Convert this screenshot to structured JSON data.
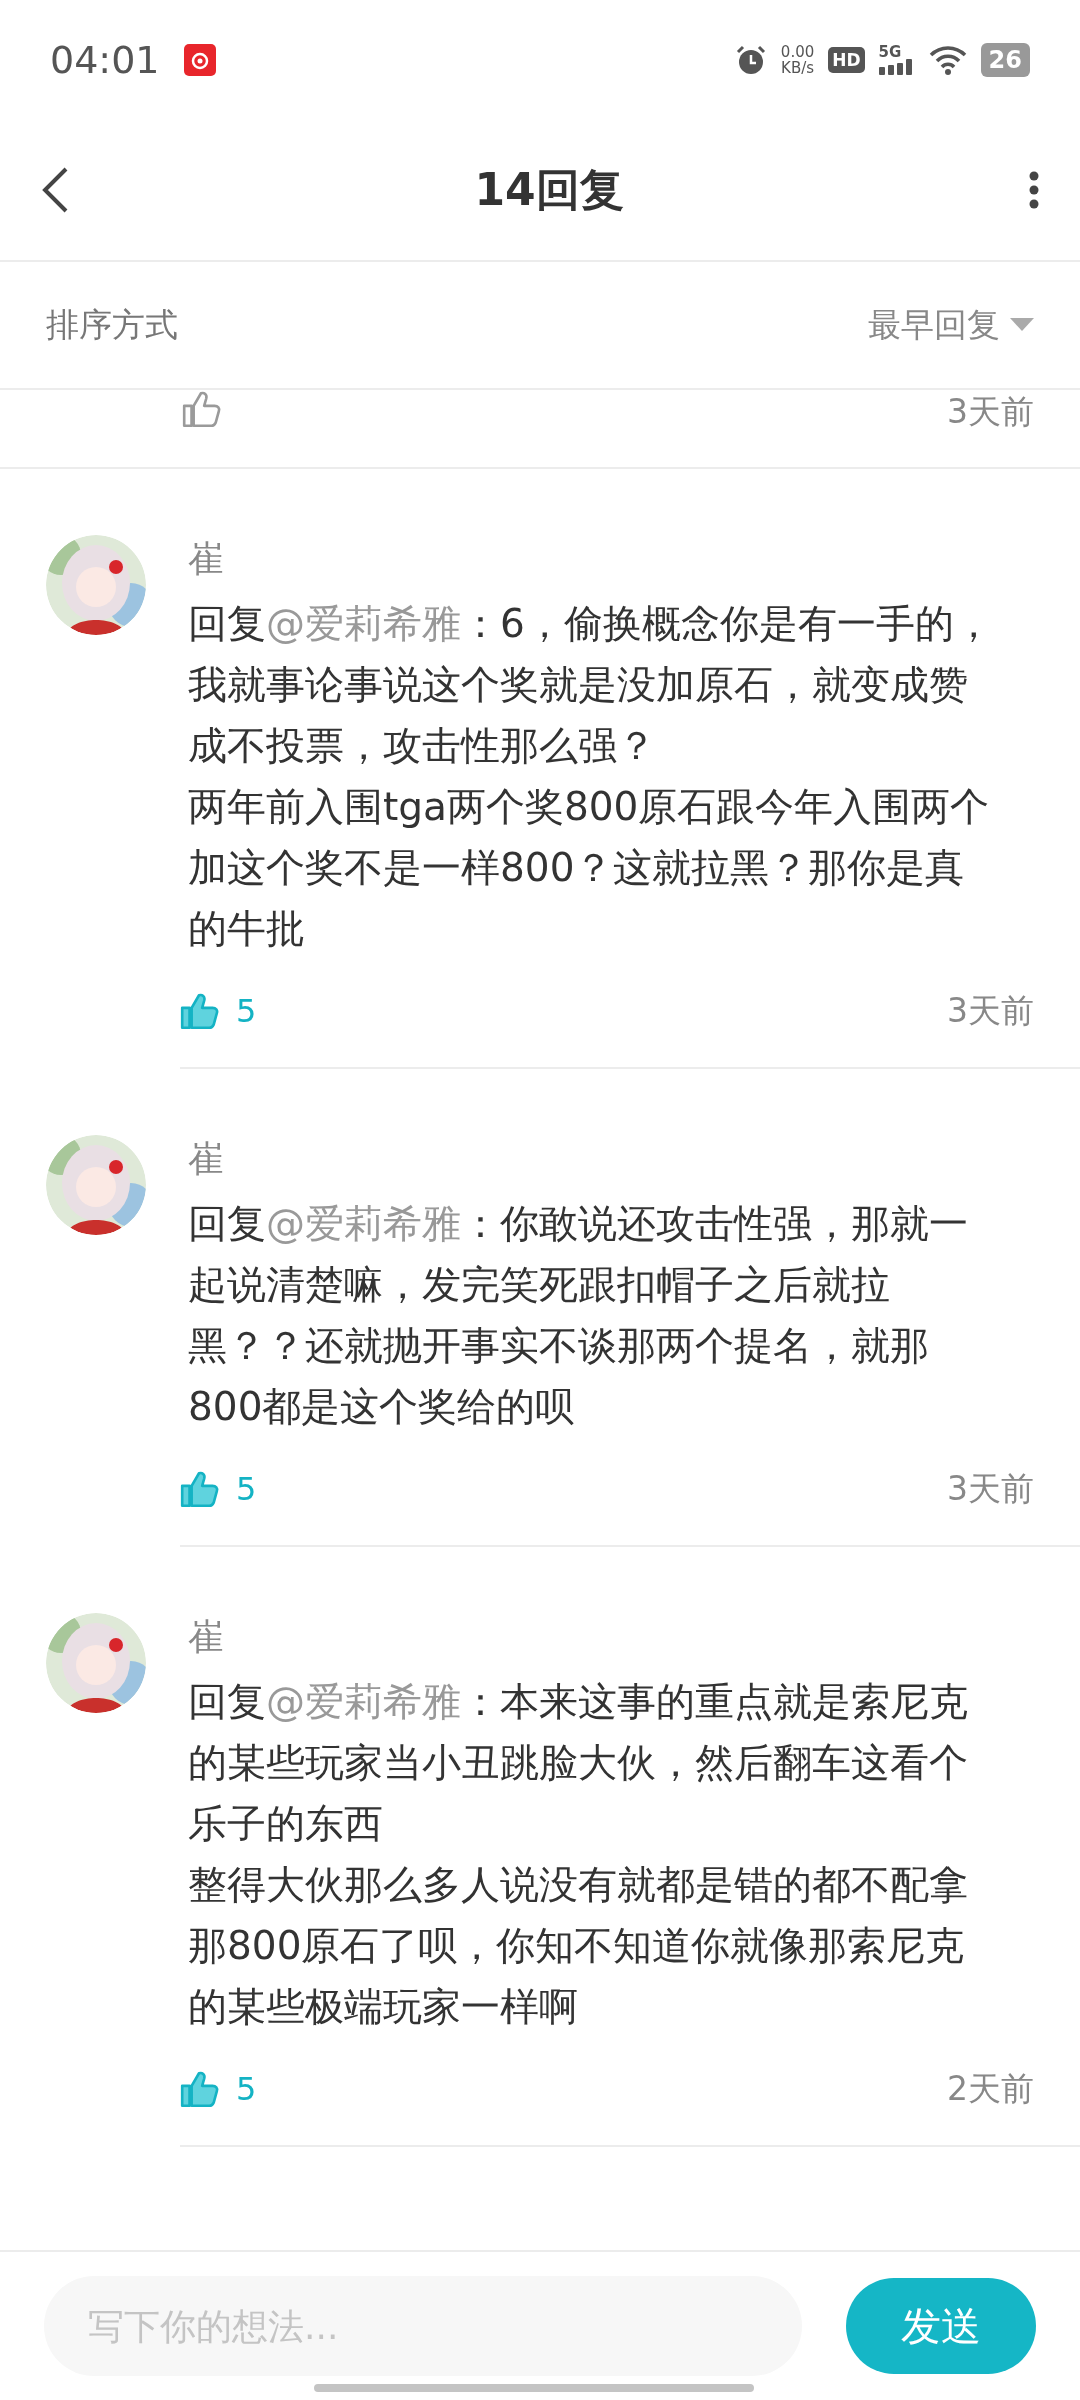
{
  "status_bar": {
    "time": "04:01",
    "net_speed": "0.00",
    "net_unit": "KB/s",
    "hd": "HD",
    "network": "5G",
    "battery": "26"
  },
  "header": {
    "title": "14回复"
  },
  "sort": {
    "label": "排序方式",
    "value": "最早回复"
  },
  "comments": [
    {
      "kind": "partial",
      "liked": false,
      "time": "3天前"
    },
    {
      "kind": "full",
      "name": "崔",
      "prefix": "回复",
      "mention": "@爱莉希雅",
      "text": "：6，偷换概念你是有一手的，我就事论事说这个奖就是没加原石，就变成赞成不投票，攻击性那么强？",
      "more_paragraphs": [
        "两年前入围tga两个奖800原石跟今年入围两个加这个奖不是一样800？这就拉黑？那你是真的牛批"
      ],
      "liked": true,
      "likes": "5",
      "time": "3天前"
    },
    {
      "kind": "full",
      "name": "崔",
      "prefix": "回复",
      "mention": "@爱莉希雅",
      "text": "：你敢说还攻击性强，那就一起说清楚嘛，发完笑死跟扣帽子之后就拉黑？？还就抛开事实不谈那两个提名，就那800都是这个奖给的呗",
      "liked": true,
      "likes": "5",
      "time": "3天前"
    },
    {
      "kind": "full",
      "name": "崔",
      "prefix": "回复",
      "mention": "@爱莉希雅",
      "text": "：本来这事的重点就是索尼克的某些玩家当小丑跳脸大伙，然后翻车这看个乐子的东西",
      "more_paragraphs": [
        "整得大伙那么多人说没有就都是错的都不配拿那800原石了呗，你知不知道你就像那索尼克的某些极端玩家一样啊"
      ],
      "liked": true,
      "likes": "5",
      "time": "2天前"
    }
  ],
  "composer": {
    "placeholder": "写下你的想法...",
    "send": "发送"
  }
}
